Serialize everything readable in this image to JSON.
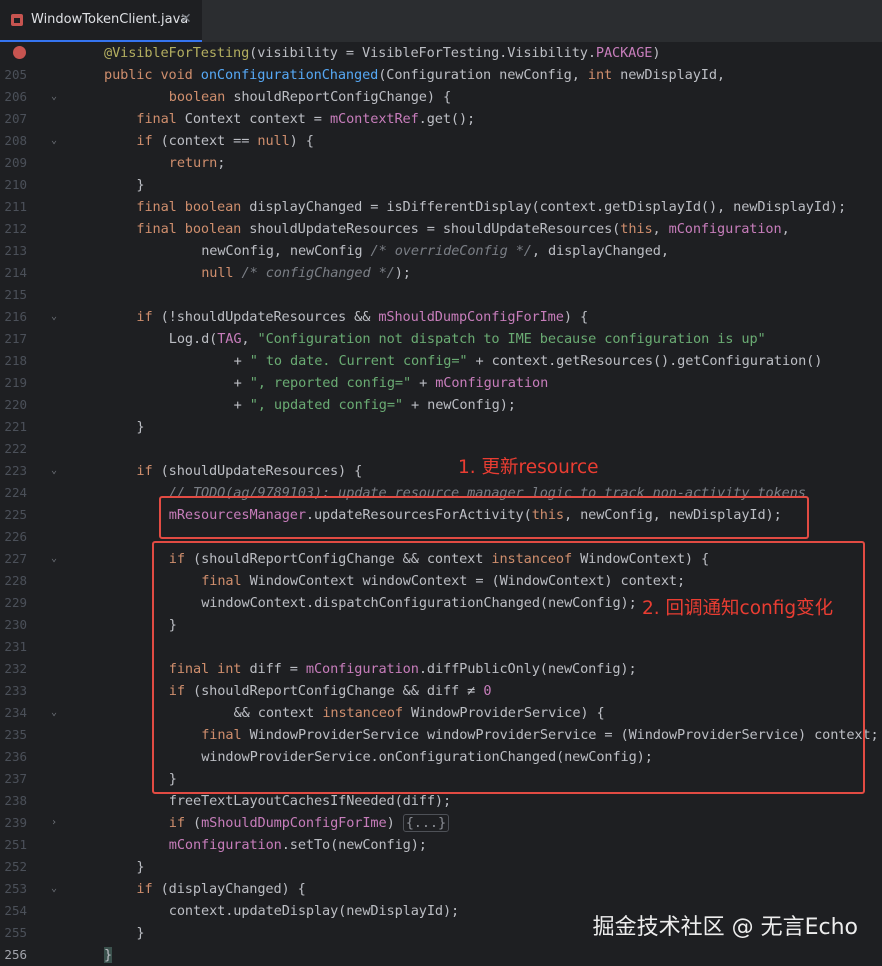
{
  "tab": {
    "filename": "WindowTokenClient.java"
  },
  "lines": [
    {
      "n": "",
      "breakpoint": true,
      "fold": "",
      "indent": 0,
      "segs": [
        [
          "ann",
          "@VisibleForTesting"
        ],
        [
          "par",
          "(visibility = VisibleForTesting.Visibility."
        ],
        [
          "fld",
          "PACKAGE"
        ],
        [
          "par",
          ")"
        ]
      ]
    },
    {
      "n": "205",
      "fold": "",
      "indent": 0,
      "segs": [
        [
          "kw",
          "public void "
        ],
        [
          "fn",
          "onConfigurationChanged"
        ],
        [
          "par",
          "(Configuration newConfig, "
        ],
        [
          "kw",
          "int "
        ],
        [
          "par",
          "newDisplayId,"
        ]
      ]
    },
    {
      "n": "206",
      "fold": "v",
      "indent": 2,
      "segs": [
        [
          "kw",
          "boolean "
        ],
        [
          "par",
          "shouldReportConfigChange) {"
        ]
      ]
    },
    {
      "n": "207",
      "fold": "",
      "indent": 1,
      "segs": [
        [
          "kw",
          "final "
        ],
        [
          "par",
          "Context context = "
        ],
        [
          "fld",
          "mContextRef"
        ],
        [
          "par",
          ".get();"
        ]
      ]
    },
    {
      "n": "208",
      "fold": "v",
      "indent": 1,
      "segs": [
        [
          "kw",
          "if "
        ],
        [
          "par",
          "(context == "
        ],
        [
          "kw",
          "null"
        ],
        [
          "par",
          ") {"
        ]
      ]
    },
    {
      "n": "209",
      "fold": "",
      "indent": 2,
      "segs": [
        [
          "kw",
          "return"
        ],
        [
          "par",
          ";"
        ]
      ]
    },
    {
      "n": "210",
      "fold": "",
      "indent": 1,
      "segs": [
        [
          "par",
          "}"
        ]
      ]
    },
    {
      "n": "211",
      "fold": "",
      "indent": 1,
      "segs": [
        [
          "kw",
          "final boolean "
        ],
        [
          "par",
          "displayChanged = isDifferentDisplay(context.getDisplayId(), newDisplayId);"
        ]
      ]
    },
    {
      "n": "212",
      "fold": "",
      "indent": 1,
      "segs": [
        [
          "kw",
          "final boolean "
        ],
        [
          "par",
          "shouldUpdateResources = shouldUpdateResources("
        ],
        [
          "kw",
          "this"
        ],
        [
          "par",
          ", "
        ],
        [
          "fld",
          "mConfiguration"
        ],
        [
          "par",
          ","
        ]
      ]
    },
    {
      "n": "213",
      "fold": "",
      "indent": 3,
      "segs": [
        [
          "par",
          "newConfig, newConfig "
        ],
        [
          "cmt",
          "/* overrideConfig */"
        ],
        [
          "par",
          ", displayChanged,"
        ]
      ]
    },
    {
      "n": "214",
      "fold": "",
      "indent": 3,
      "segs": [
        [
          "kw",
          "null "
        ],
        [
          "cmt",
          "/* configChanged */"
        ],
        [
          "par",
          ");"
        ]
      ]
    },
    {
      "n": "215",
      "fold": "",
      "indent": 0,
      "segs": []
    },
    {
      "n": "216",
      "fold": "v",
      "indent": 1,
      "segs": [
        [
          "kw",
          "if "
        ],
        [
          "par",
          "(!shouldUpdateResources && "
        ],
        [
          "fld",
          "mShouldDumpConfigForIme"
        ],
        [
          "par",
          ") {"
        ]
      ]
    },
    {
      "n": "217",
      "fold": "",
      "indent": 2,
      "segs": [
        [
          "par",
          "Log."
        ],
        [
          "par",
          "d("
        ],
        [
          "fld",
          "TAG"
        ],
        [
          "par",
          ", "
        ],
        [
          "str",
          "\"Configuration not dispatch to IME because configuration is up\""
        ]
      ]
    },
    {
      "n": "218",
      "fold": "",
      "indent": 4,
      "segs": [
        [
          "par",
          "+ "
        ],
        [
          "str",
          "\" to date. Current config=\" "
        ],
        [
          "par",
          "+ context.getResources().getConfiguration()"
        ]
      ]
    },
    {
      "n": "219",
      "fold": "",
      "indent": 4,
      "segs": [
        [
          "par",
          "+ "
        ],
        [
          "str",
          "\", reported config=\" "
        ],
        [
          "par",
          "+ "
        ],
        [
          "fld",
          "mConfiguration"
        ]
      ]
    },
    {
      "n": "220",
      "fold": "",
      "indent": 4,
      "segs": [
        [
          "par",
          "+ "
        ],
        [
          "str",
          "\", updated config=\" "
        ],
        [
          "par",
          "+ newConfig);"
        ]
      ]
    },
    {
      "n": "221",
      "fold": "",
      "indent": 1,
      "segs": [
        [
          "par",
          "}"
        ]
      ]
    },
    {
      "n": "222",
      "fold": "",
      "indent": 0,
      "segs": []
    },
    {
      "n": "223",
      "fold": "v",
      "indent": 1,
      "segs": [
        [
          "kw",
          "if "
        ],
        [
          "par",
          "(shouldUpdateResources) {"
        ]
      ]
    },
    {
      "n": "224",
      "fold": "",
      "indent": 2,
      "segs": [
        [
          "cmt",
          "// TODO(ag/9789103): update resource manager logic to track non-activity tokens"
        ]
      ]
    },
    {
      "n": "225",
      "fold": "",
      "indent": 2,
      "segs": [
        [
          "fld",
          "mResourcesManager"
        ],
        [
          "par",
          ".updateResourcesForActivity("
        ],
        [
          "kw",
          "this"
        ],
        [
          "par",
          ", newConfig, newDisplayId);"
        ]
      ]
    },
    {
      "n": "226",
      "fold": "",
      "indent": 0,
      "segs": []
    },
    {
      "n": "227",
      "fold": "v",
      "indent": 2,
      "segs": [
        [
          "kw",
          "if "
        ],
        [
          "par",
          "(shouldReportConfigChange && context "
        ],
        [
          "kw",
          "instanceof "
        ],
        [
          "par",
          "WindowContext) {"
        ]
      ]
    },
    {
      "n": "228",
      "fold": "",
      "indent": 3,
      "segs": [
        [
          "kw",
          "final "
        ],
        [
          "par",
          "WindowContext windowContext = (WindowContext) context;"
        ]
      ]
    },
    {
      "n": "229",
      "fold": "",
      "indent": 3,
      "segs": [
        [
          "par",
          "windowContext.dispatchConfigurationChanged(newConfig);"
        ]
      ]
    },
    {
      "n": "230",
      "fold": "",
      "indent": 2,
      "segs": [
        [
          "par",
          "}"
        ]
      ]
    },
    {
      "n": "231",
      "fold": "",
      "indent": 0,
      "segs": []
    },
    {
      "n": "232",
      "fold": "",
      "indent": 2,
      "segs": [
        [
          "kw",
          "final int "
        ],
        [
          "par",
          "diff = "
        ],
        [
          "fld",
          "mConfiguration"
        ],
        [
          "par",
          ".diffPublicOnly(newConfig);"
        ]
      ]
    },
    {
      "n": "233",
      "fold": "",
      "indent": 2,
      "segs": [
        [
          "kw",
          "if "
        ],
        [
          "par",
          "(shouldReportConfigChange && diff ≠ "
        ],
        [
          "fld",
          "0"
        ]
      ]
    },
    {
      "n": "234",
      "fold": "v",
      "indent": 4,
      "segs": [
        [
          "par",
          "&& context "
        ],
        [
          "kw",
          "instanceof "
        ],
        [
          "par",
          "WindowProviderService) {"
        ]
      ]
    },
    {
      "n": "235",
      "fold": "",
      "indent": 3,
      "segs": [
        [
          "kw",
          "final "
        ],
        [
          "par",
          "WindowProviderService windowProviderService = (WindowProviderService) context;"
        ]
      ]
    },
    {
      "n": "236",
      "fold": "",
      "indent": 3,
      "segs": [
        [
          "par",
          "windowProviderService.onConfigurationChanged(newConfig);"
        ]
      ]
    },
    {
      "n": "237",
      "fold": "",
      "indent": 2,
      "segs": [
        [
          "par",
          "}"
        ]
      ]
    },
    {
      "n": "238",
      "fold": "",
      "indent": 2,
      "segs": [
        [
          "par",
          "freeTextLayoutCachesIfNeeded(diff);"
        ]
      ]
    },
    {
      "n": "239",
      "fold": ">",
      "indent": 2,
      "segs": [
        [
          "kw",
          "if "
        ],
        [
          "par",
          "("
        ],
        [
          "fld",
          "mShouldDumpConfigForIme"
        ],
        [
          "par",
          ") "
        ],
        [
          "box",
          "{...}"
        ]
      ]
    },
    {
      "n": "251",
      "fold": "",
      "indent": 2,
      "segs": [
        [
          "fld",
          "mConfiguration"
        ],
        [
          "par",
          ".setTo(newConfig);"
        ]
      ]
    },
    {
      "n": "252",
      "fold": "",
      "indent": 1,
      "segs": [
        [
          "par",
          "}"
        ]
      ]
    },
    {
      "n": "253",
      "fold": "v",
      "indent": 1,
      "segs": [
        [
          "kw",
          "if "
        ],
        [
          "par",
          "(displayChanged) {"
        ]
      ]
    },
    {
      "n": "254",
      "fold": "",
      "indent": 2,
      "segs": [
        [
          "par",
          "context.updateDisplay(newDisplayId);"
        ]
      ]
    },
    {
      "n": "255",
      "fold": "",
      "indent": 1,
      "segs": [
        [
          "par",
          "}"
        ]
      ]
    },
    {
      "n": "256",
      "fold": "",
      "indent": 0,
      "current": true,
      "segs": [
        [
          "brace",
          "}"
        ]
      ]
    }
  ],
  "annotations": {
    "label1": "1. 更新resource",
    "label2": "2. 回调通知config变化"
  },
  "watermark": "掘金技术社区 @ 无言Echo",
  "colors": {
    "highlight_box": "#e24b43",
    "label": "#ea3d32"
  }
}
